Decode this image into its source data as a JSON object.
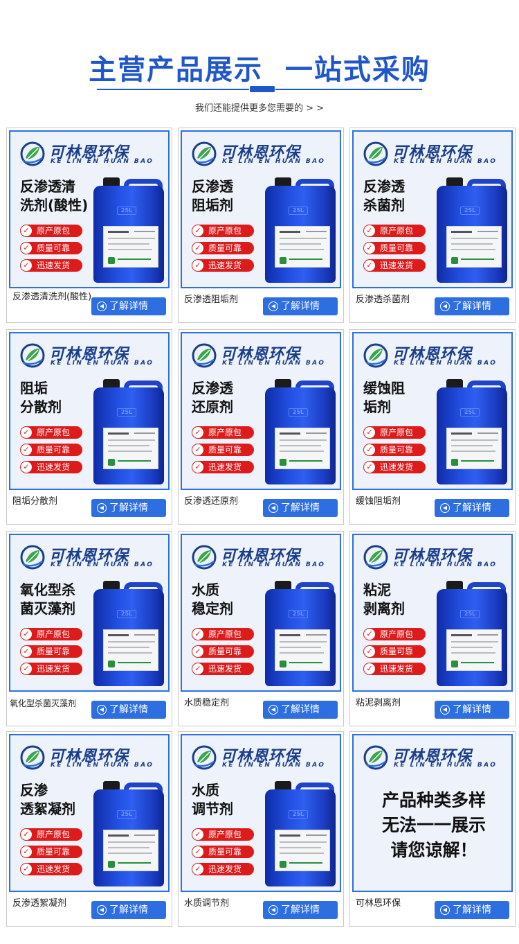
{
  "header": {
    "title": "主营产品展示  一站式采购",
    "subtitle": "我们还能提供更多您需要的 > >"
  },
  "brand": {
    "name_cn": "可林恩环保",
    "name_en": "KE LIN EN HUAN BAO"
  },
  "colors": {
    "accent": "#2d6fe0",
    "tag_red": "#dd1b1b",
    "title_blue": "#1f56c9"
  },
  "tags": [
    "原产原包",
    "质量可靠",
    "迅速发货"
  ],
  "drum_emboss": "25L",
  "button_label": "了解详情",
  "products": [
    {
      "name": "反渗透清洗剂(酸性)",
      "footer": "反渗透清洗剂(酸性)"
    },
    {
      "name": "反渗透阻垢剂",
      "footer": "反渗透阻垢剂"
    },
    {
      "name": "反渗透杀菌剂",
      "footer": "反渗透杀菌剂"
    },
    {
      "name": "阻垢分散剂",
      "footer": "阻垢分散剂"
    },
    {
      "name": "反渗透还原剂",
      "footer": "反渗透还原剂"
    },
    {
      "name": "缓蚀阻垢剂",
      "footer": "缓蚀阻垢剂"
    },
    {
      "name": "氧化型杀菌灭藻剂",
      "footer": "氧化型杀菌灭藻剂"
    },
    {
      "name": "水质稳定剂",
      "footer": "水质稳定剂"
    },
    {
      "name": "粘泥剥离剂",
      "footer": "粘泥剥离剂"
    },
    {
      "name": "反渗透絮凝剂",
      "footer": "反渗透絮凝剂"
    },
    {
      "name": "水质调节剂",
      "footer": "水质调节剂"
    }
  ],
  "notice_card": {
    "lines": [
      "产品种类多样",
      "无法一一展示",
      "请您谅解！"
    ],
    "footer": "可林恩环保"
  }
}
